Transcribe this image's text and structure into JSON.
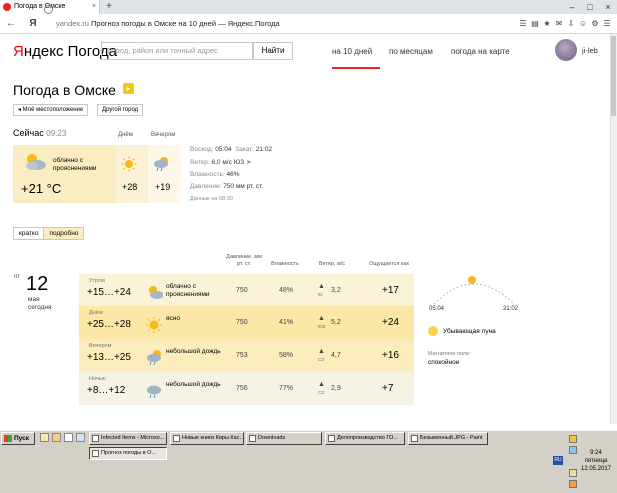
{
  "browser": {
    "tab_title": "Погода в Омске",
    "tab_close": "×",
    "new_tab": "+",
    "back": "←",
    "yandex_btn": "Я",
    "url_host": "yandex.ru",
    "url_title": "Прогноз погоды в Омске на 10 дней — Яндекс.Погода",
    "ext_icons": [
      "☰",
      "▤",
      "★",
      "✉",
      "⇩",
      "☺",
      "⚙",
      "☰"
    ]
  },
  "header": {
    "logo_ya": "Я",
    "logo_rest": "ндекс",
    "logo_product": "Погода",
    "search_placeholder": "Город, район или точный адрес",
    "find_button": "Найти",
    "tabs": [
      "на 10 дней",
      "по месяцам",
      "погода на карте"
    ],
    "username": "ji-leb"
  },
  "title": {
    "text": "Погода в Омске",
    "my_location": "◂ Моё местоположение",
    "other_city": "Другой город"
  },
  "now": {
    "label": "Сейчас",
    "time": "09:23",
    "day_label": "Днём",
    "evening_label": "Вечером",
    "condition": "облачно с прояснениями",
    "temp": "+21 °C",
    "day_temp": "+28",
    "evening_temp": "+19"
  },
  "details": {
    "sunrise_label": "Восход:",
    "sunrise": "05:04",
    "sunset_label": "Закат:",
    "sunset": "21:02",
    "wind_label": "Ветер:",
    "wind": "6,0 м/с",
    "wind_dir": "ЮЗ",
    "humidity_label": "Влажность:",
    "humidity": "46%",
    "pressure_label": "Давление:",
    "pressure": "750 мм рт. ст.",
    "data_time": "Данные на 08:30"
  },
  "view_toggle": {
    "short": "кратко",
    "detailed": "подробно"
  },
  "columns": {
    "pressure": "Давление, мм рт. ст.",
    "humidity": "Влажность",
    "wind": "Ветер, м/с",
    "feels_like": "Ощущается как"
  },
  "date": {
    "dow": "пт",
    "day": "12",
    "month": "мая",
    "today": "сегодня"
  },
  "forecast": [
    {
      "part": "Утром",
      "temp": "+15…+24",
      "condition": "облачно с прояснениями",
      "pressure": "750",
      "humidity": "48%",
      "wind_dir": "Ю",
      "wind": "3,2",
      "feels": "+17",
      "bg": "#fbf3d8",
      "icon": "cloud-sun"
    },
    {
      "part": "Днём",
      "temp": "+25…+28",
      "condition": "ясно",
      "pressure": "750",
      "humidity": "41%",
      "wind_dir": "ЮЗ",
      "wind": "5,2",
      "feels": "+24",
      "bg": "#fbe7a6",
      "icon": "sun"
    },
    {
      "part": "Вечером",
      "temp": "+13…+25",
      "condition": "небольшой дождь",
      "pressure": "753",
      "humidity": "58%",
      "wind_dir": "СЗ",
      "wind": "4,7",
      "feels": "+16",
      "bg": "#fcedbd",
      "icon": "rain-sun"
    },
    {
      "part": "Ночью",
      "temp": "+8…+12",
      "condition": "небольшой дождь",
      "pressure": "756",
      "humidity": "77%",
      "wind_dir": "СЗ",
      "wind": "2,9",
      "feels": "+7",
      "bg": "#f6f3e4",
      "icon": "rain"
    }
  ],
  "astro": {
    "sunrise": "05:04",
    "sunset": "21:02",
    "moon": "Убывающая луна",
    "magnetic_label": "Магнитное поле:",
    "magnetic": "спокойное"
  },
  "taskbar": {
    "start": "Пуск",
    "buttons": [
      "Infected Items - Microso...",
      "Новые книги Киры Кас...",
      "Downloads",
      "Делопроизводство ГО...",
      "Безымянный.JPG - Paint",
      "Прогноз погоды в О..."
    ],
    "lang": "RU",
    "time": "9:24",
    "weekday": "пятница",
    "date": "12.05.2017"
  }
}
